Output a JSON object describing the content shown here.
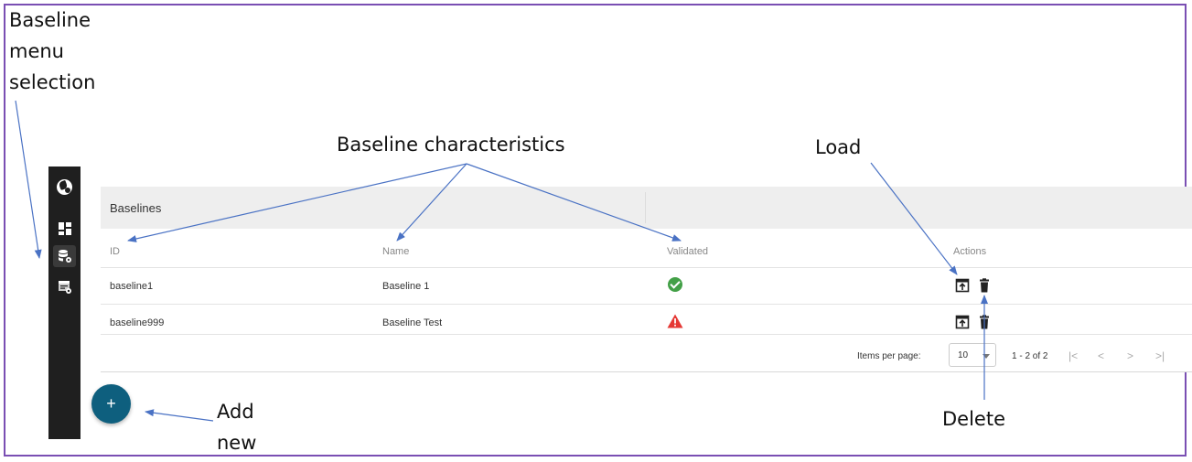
{
  "annotations": {
    "baseline_menu": [
      "Baseline",
      "menu",
      "selection"
    ],
    "characteristics": "Baseline characteristics",
    "load": "Load",
    "delete": "Delete",
    "add_new": [
      "Add",
      "new"
    ]
  },
  "sidebar": {
    "items": [
      {
        "icon": "app-logo-icon"
      },
      {
        "icon": "dashboard-icon"
      },
      {
        "icon": "database-settings-icon",
        "active": true
      },
      {
        "icon": "table-settings-icon"
      }
    ]
  },
  "table": {
    "title": "Baselines",
    "columns": [
      "ID",
      "Name",
      "Validated",
      "Actions"
    ],
    "rows": [
      {
        "id": "baseline1",
        "name": "Baseline 1",
        "validated": "check-circle-icon"
      },
      {
        "id": "baseline999",
        "name": "Baseline Test",
        "validated": "warning-icon"
      }
    ],
    "actions": [
      "load-icon",
      "delete-icon"
    ]
  },
  "paginator": {
    "items_per_page_label": "Items per page:",
    "page_size": "10",
    "range": "1 - 2 of 2",
    "nav": [
      "|<",
      "<",
      ">",
      ">|"
    ]
  },
  "fab": {
    "label": "+"
  },
  "colors": {
    "frame": "#7a4fb3",
    "arrow": "#4a72c4",
    "fab": "#0e5f7e",
    "ok": "#43a047",
    "warn": "#e53935",
    "sidebar": "#1f1f1f"
  }
}
